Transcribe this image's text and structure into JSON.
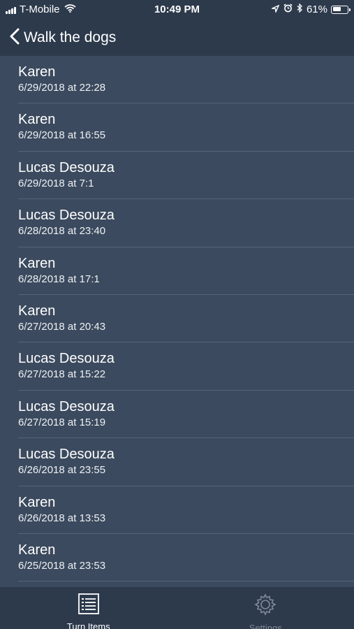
{
  "status_bar": {
    "carrier": "T-Mobile",
    "time": "10:49 PM",
    "battery_percent": "61%",
    "battery_level": 0.61,
    "icons": [
      "signal-icon",
      "wifi-icon",
      "location-icon",
      "alarm-icon",
      "bluetooth-icon",
      "battery-icon"
    ]
  },
  "nav": {
    "back_icon": "chevron-left-icon",
    "title": "Walk the dogs"
  },
  "list": {
    "items": [
      {
        "name": "Karen",
        "date": "6/29/2018 at 22:28"
      },
      {
        "name": "Karen",
        "date": "6/29/2018 at 16:55"
      },
      {
        "name": "Lucas Desouza",
        "date": "6/29/2018 at 7:1"
      },
      {
        "name": "Lucas Desouza",
        "date": "6/28/2018 at 23:40"
      },
      {
        "name": "Karen",
        "date": "6/28/2018 at 17:1"
      },
      {
        "name": "Karen",
        "date": "6/27/2018 at 20:43"
      },
      {
        "name": "Lucas Desouza",
        "date": "6/27/2018 at 15:22"
      },
      {
        "name": "Lucas Desouza",
        "date": "6/27/2018 at 15:19"
      },
      {
        "name": "Lucas Desouza",
        "date": "6/26/2018 at 23:55"
      },
      {
        "name": "Karen",
        "date": "6/26/2018 at 13:53"
      },
      {
        "name": "Karen",
        "date": "6/25/2018 at 23:53"
      }
    ]
  },
  "tab_bar": {
    "tabs": [
      {
        "label": "Turn Items",
        "icon": "list-icon",
        "active": true
      },
      {
        "label": "Settings",
        "icon": "gear-icon",
        "active": false
      }
    ]
  },
  "colors": {
    "background": "#3b4a5e",
    "bars": "#2d3a4c",
    "separator": "#56647a",
    "inactive_tab": "#7f8a99"
  }
}
